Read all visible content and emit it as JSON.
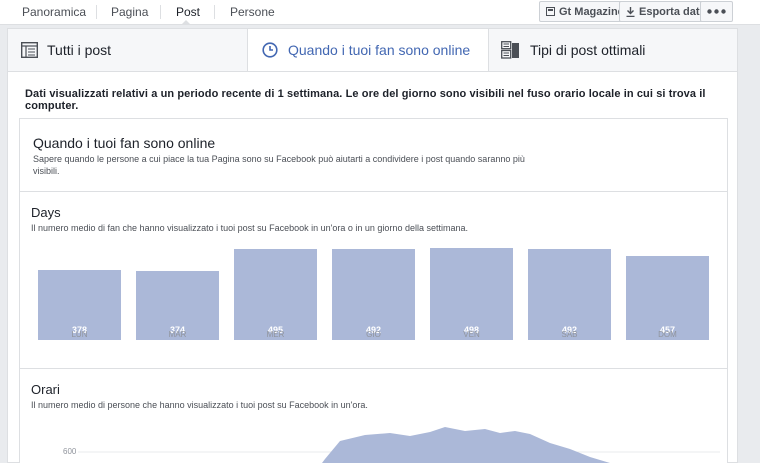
{
  "topnav": {
    "tabs": [
      "Panoramica",
      "Pagina",
      "Post",
      "Persone"
    ],
    "active": "Post",
    "gt_label": "Gt Magazine",
    "export_label": "Esporta dati"
  },
  "subtabs": [
    {
      "label": "Tutti i post",
      "icon": "list-icon"
    },
    {
      "label": "Quando i tuoi fan sono online",
      "icon": "clock-icon",
      "active": true
    },
    {
      "label": "Tipi di post ottimali",
      "icon": "post-types-icon"
    }
  ],
  "notice": "Dati visualizzati relativi a un periodo recente di 1 settimana. Le ore del giorno sono visibili nel fuso orario locale in cui si trova il computer.",
  "card": {
    "title": "Quando i tuoi fan sono online",
    "desc": "Sapere quando le persone a cui piace la tua Pagina sono su Facebook può aiutarti a condividere i post quando saranno più visibili."
  },
  "days": {
    "title": "Days",
    "desc": "Il numero medio di fan che hanno visualizzato i tuoi post su Facebook in un'ora o in un giorno della settimana."
  },
  "hours": {
    "title": "Orari",
    "desc": "Il numero medio di persone che hanno visualizzato i tuoi post su Facebook in un'ora.",
    "tick": "600"
  },
  "chart_data": [
    {
      "type": "bar",
      "categories": [
        "LUN",
        "MAR",
        "MER",
        "GIO",
        "VEN",
        "SAB",
        "DOM"
      ],
      "values": [
        378,
        374,
        495,
        492,
        498,
        492,
        457
      ],
      "value_labels": [
        "378",
        "374",
        "495",
        "492",
        "498",
        "492",
        "457"
      ],
      "title": "Days",
      "ylim": [
        0,
        500
      ],
      "color": "#abb8d8"
    },
    {
      "type": "area",
      "title": "Orari",
      "ytick": 600,
      "color": "#abb8d8"
    }
  ],
  "colors": {
    "accent": "#4267b2",
    "bar": "#abb8d8"
  }
}
